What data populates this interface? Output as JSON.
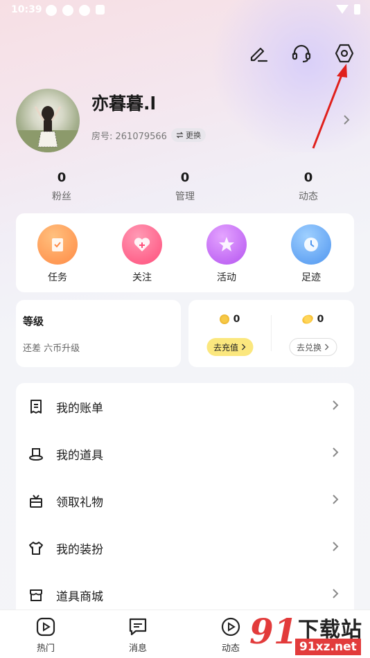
{
  "status_bar": {
    "time": "10:39"
  },
  "profile": {
    "username": "亦暮暮.l",
    "room_number": "房号: 261079566",
    "swap_label": "更换"
  },
  "stats": [
    {
      "value": "0",
      "label": "粉丝"
    },
    {
      "value": "0",
      "label": "管理"
    },
    {
      "value": "0",
      "label": "动态"
    }
  ],
  "quick_actions": [
    {
      "label": "任务",
      "icon": "task-icon",
      "color": "#ff9d5c"
    },
    {
      "label": "关注",
      "icon": "heart-icon",
      "color": "#ff5b86"
    },
    {
      "label": "活动",
      "icon": "star-icon",
      "color": "#c66cf5"
    },
    {
      "label": "足迹",
      "icon": "clock-icon",
      "color": "#5aa3f5"
    }
  ],
  "level_card": {
    "title": "等级",
    "subtitle": "还差  六币升级"
  },
  "wallet": {
    "coins": {
      "amount": "0",
      "button": "去充值"
    },
    "beans": {
      "amount": "0",
      "button": "去兑换"
    }
  },
  "menu": [
    {
      "label": "我的账单",
      "icon": "bill-icon"
    },
    {
      "label": "我的道具",
      "icon": "hat-icon"
    },
    {
      "label": "领取礼物",
      "icon": "gift-icon"
    },
    {
      "label": "我的装扮",
      "icon": "shirt-icon"
    },
    {
      "label": "道具商城",
      "icon": "store-icon"
    }
  ],
  "bottom_nav": [
    {
      "label": "热门",
      "icon": "play-icon"
    },
    {
      "label": "消息",
      "icon": "message-icon"
    },
    {
      "label": "动态",
      "icon": "play-circle-icon"
    }
  ],
  "watermark": {
    "number": "91",
    "text": "下载站",
    "url": "91xz.net"
  }
}
